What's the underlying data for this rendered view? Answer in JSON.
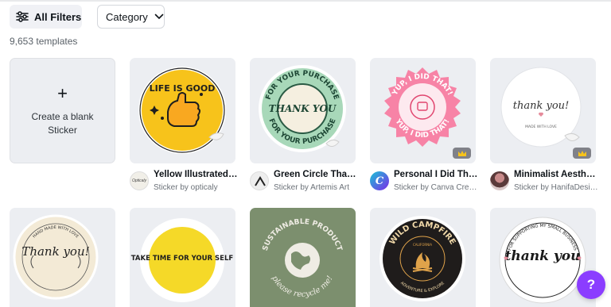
{
  "toolbar": {
    "all_filters_label": "All Filters",
    "category_label": "Category"
  },
  "results": {
    "count_label": "9,653 templates"
  },
  "blank_tile": {
    "plus": "+",
    "label": "Create a blank Sticker"
  },
  "templates": [
    {
      "title": "Yellow Illustrated…",
      "byline": "Sticker by opticaly",
      "avatar_text": "Opticaly",
      "premium": false,
      "sticker_text": "LIFE IS GOOD"
    },
    {
      "title": "Green Circle Than…",
      "byline": "Sticker by Artemis Art",
      "premium": false,
      "sticker_text_outer": "FOR YOUR PURCHASE",
      "sticker_text_center": "THANK YOU"
    },
    {
      "title": "Personal I Did Th…",
      "byline": "Sticker by Canva Cre…",
      "avatar_text": "C",
      "premium": true,
      "sticker_text": "YUP, I DID THAT!"
    },
    {
      "title": "Minimalist Aesth…",
      "byline": "Sticker by HanifaDesi…",
      "premium": true,
      "sticker_text": "thank you!",
      "sticker_subtext": "MADE WITH LOVE"
    }
  ],
  "row2": [
    {
      "sticker_text": "Thank you!",
      "sticker_subtext": "HAND MADE WITH LOVE"
    },
    {
      "sticker_text": "TAKE TIME FOR YOUR SELF"
    },
    {
      "sticker_text": "SUSTAINABLE PRODUCT",
      "sticker_subtext": "please recycle me!"
    },
    {
      "sticker_text": "WILD CAMPFIRE",
      "sticker_subtext": "ADVENTURE & EXPLORE",
      "sticker_small": "CALIFORNIA"
    },
    {
      "sticker_text": "thank you",
      "sticker_subtext": "FOR SUPPORTING MY SMALL BUSINESS"
    }
  ],
  "help": {
    "label": "?"
  },
  "colors": {
    "accent": "#8b3dff",
    "tile_bg": "#eceef2",
    "yellow": "#f7c31b",
    "green_mint": "#a8d8b9",
    "pink": "#f783a6",
    "olive": "#7c8f6e"
  }
}
